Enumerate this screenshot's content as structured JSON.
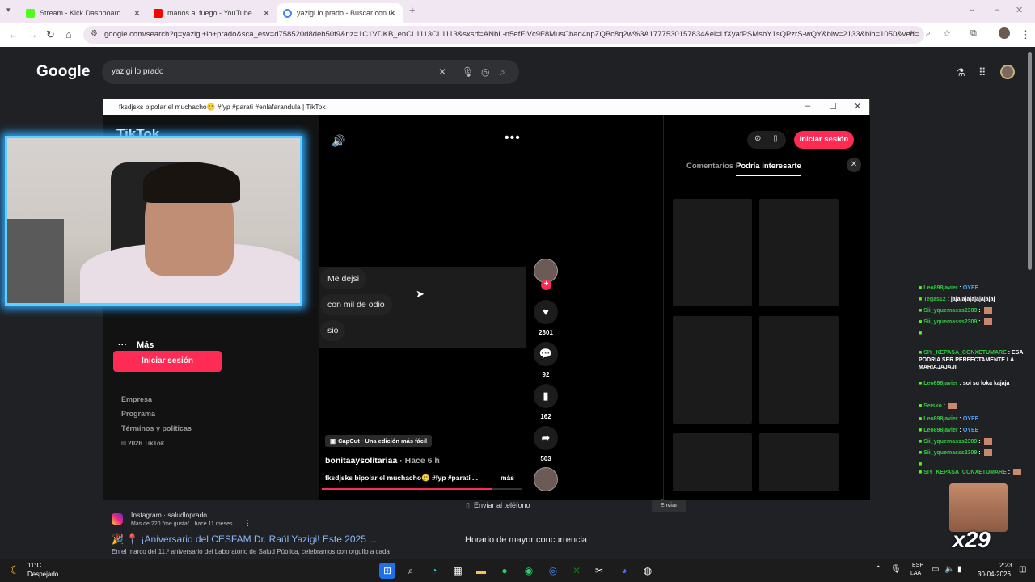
{
  "browser": {
    "tabs": [
      {
        "label": "Stream - Kick Dashboard",
        "color": "#53fc18"
      },
      {
        "label": "manos al fuego - YouTube",
        "color": "#ff0000"
      },
      {
        "label": "yazigi lo prado - Buscar con Go",
        "color": "#4285f4"
      }
    ],
    "new_tab": "+",
    "url": "google.com/search?q=yazigi+lo+prado&sca_esv=d758520d8deb50f9&rlz=1C1VDKB_enCL1113CL1113&sxsrf=ANbL-n5efEiVc9F8MusCbad4npZQBc8q2w%3A1777530157834&ei=LfXyafPSMsbY1sQPzrS-wQY&biw=2133&bih=1050&ved=..."
  },
  "google": {
    "logo": "Google",
    "query": "yazigi lo prado"
  },
  "popup": {
    "title": "fksdjsks bipolar el muchacho🥲 #fyp #parati #enlafarandula | TikTok"
  },
  "tiktok": {
    "logo": "TikTok",
    "more_label": "Más",
    "login_label": "Iniciar sesión",
    "footer": {
      "links": [
        "Empresa",
        "Programa",
        "Términos y políticas"
      ],
      "copyright": "© 2026 TikTok"
    },
    "video": {
      "options": [
        "Me dejsi",
        "con mil de odio",
        "sio"
      ],
      "capcut": "CapCut · Una edición más fácil",
      "author": "bonitaaysolitariaa",
      "time": "· Hace 6 h",
      "caption": "fksdjsks bipolar el muchacho🥲 #fyp #parati ...",
      "more": "más",
      "progress": 0.85
    },
    "actions": {
      "likes": "2801",
      "comments": "92",
      "saves": "162",
      "shares": "503"
    },
    "right": {
      "login_label": "Iniciar sesión",
      "tab_comments": "Comentarios",
      "tab_suggest": "Podría interesarte"
    }
  },
  "results": {
    "source": "Instagram · saludloprado",
    "meta": "Más de 220 \"me gusta\" · hace 11 meses",
    "title": "🎉 📍 ¡Aniversario del CESFAM Dr. Raúl Yazigi! Este 2025 ...",
    "snippet": "En el marco del 11.º aniversario del Laboratorio de Salud Pública, celebramos con orgullo a cada",
    "send_phone": "Enviar al teléfono",
    "send_button": "Enviar",
    "busy_heading": "Horario de mayor concurrencia"
  },
  "chat": [
    {
      "user": "Leo898javier",
      "msg": "OYEE"
    },
    {
      "user": "Tegas12",
      "msg": "jajajajajajajajajaj"
    },
    {
      "user": "Sii_yquemasss2309",
      "msg": ""
    },
    {
      "user": "Sii_yquemasss2309",
      "msg": ""
    },
    {
      "user": "",
      "msg": ""
    },
    {
      "user": "SIY_KEPASA_CONXETUMARE",
      "msg": "ESA PODRIA SER PERFECTAMENTE LA MARIAJAJAJI"
    },
    {
      "user": "Leo898javier",
      "msg": "soi su loka kajaja"
    },
    {
      "user": "Seisko",
      "msg": ""
    },
    {
      "user": "Leo898javier",
      "msg": "OYEE"
    },
    {
      "user": "Leo898javier",
      "msg": "OYEE"
    },
    {
      "user": "Sii_yquemasss2309",
      "msg": ""
    },
    {
      "user": "Sii_yquemasss2309",
      "msg": ""
    },
    {
      "user": "",
      "msg": ""
    },
    {
      "user": "SIY_KEPASA_CONXETUMARE",
      "msg": ""
    }
  ],
  "combo": "x29",
  "taskbar": {
    "temp": "11°C",
    "weather": "Despejado",
    "lang1": "ESP",
    "lang2": "LAA",
    "time": "2:23",
    "date": "30-04-2026"
  }
}
